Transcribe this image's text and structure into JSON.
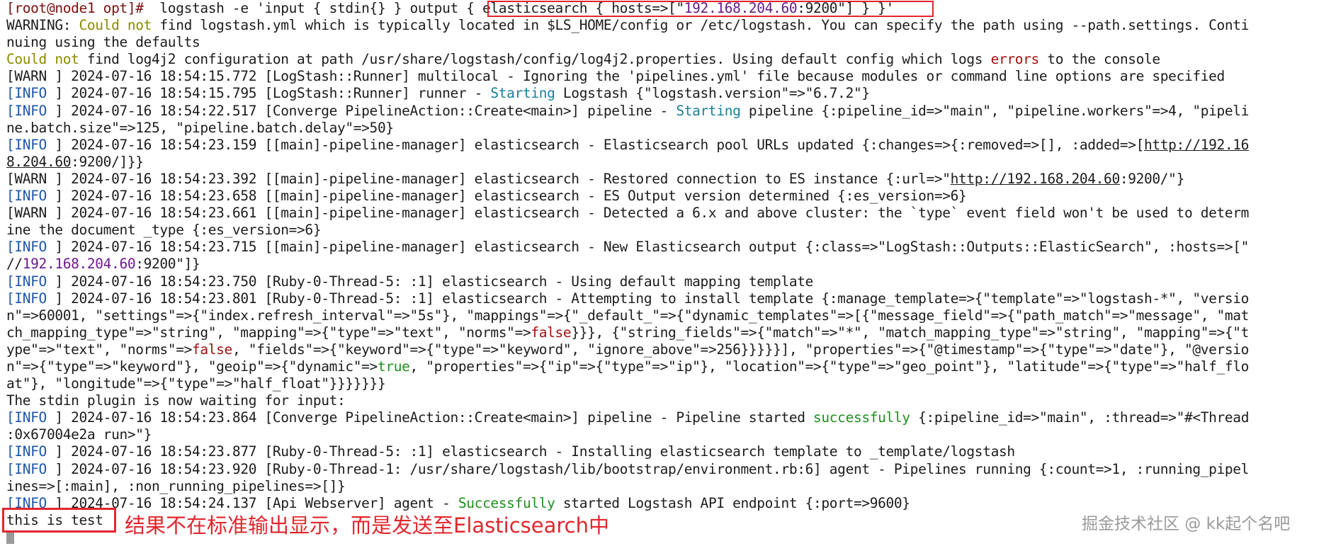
{
  "terminal": {
    "lines": [
      [
        {
          "t": "[root@node1 opt]#",
          "c": "prompt"
        },
        {
          "t": "  logstash -e 'input { stdin{} } output "
        },
        {
          "t": "{ elasticsearch { hosts=>[\""
        },
        {
          "t": "192.168.204.60",
          "c": "ip"
        },
        {
          "t": ":9200\"] } }"
        },
        {
          "t": "'"
        }
      ],
      [
        {
          "t": "WARNING: "
        },
        {
          "t": "Could not",
          "c": "warnword"
        },
        {
          "t": " find logstash.yml which is typically located in $LS_HOME/config or /etc/logstash. You can specify the path using --path.settings. Conti"
        }
      ],
      [
        {
          "t": "nuing using the defaults"
        }
      ],
      [
        {
          "t": "Could not",
          "c": "warnword"
        },
        {
          "t": " find log4j2 configuration at path /usr/share/logstash/config/log4j2.properties. Using default config which logs "
        },
        {
          "t": "errors",
          "c": "keyword"
        },
        {
          "t": " to the console"
        }
      ],
      [
        {
          "t": "[WARN ] 2024-07-16 18:54:15.772 [LogStash::Runner] multilocal - Ignoring the 'pipelines.yml' file because modules or command line options are specified"
        }
      ],
      [
        {
          "t": "[",
          "c": "bracket"
        },
        {
          "t": "INFO",
          "c": "bracket"
        },
        {
          "t": " ] 2024-07-16 18:54:15.795 [LogStash::Runner] runner - "
        },
        {
          "t": "Starting",
          "c": "starting"
        },
        {
          "t": " Logstash {\"logstash.version\"=>\"6.7.2\"}"
        }
      ],
      [
        {
          "t": "[",
          "c": "bracket"
        },
        {
          "t": "INFO",
          "c": "bracket"
        },
        {
          "t": " ] 2024-07-16 18:54:22.517 [Converge PipelineAction::Create<main>] pipeline - "
        },
        {
          "t": "Starting",
          "c": "starting"
        },
        {
          "t": " pipeline {:pipeline_id=>\"main\", \"pipeline.workers\"=>4, \"pipeli"
        }
      ],
      [
        {
          "t": "ne.batch.size\"=>125, \"pipeline.batch.delay\"=>50}"
        }
      ],
      [
        {
          "t": "[",
          "c": "bracket"
        },
        {
          "t": "INFO",
          "c": "bracket"
        },
        {
          "t": " ] 2024-07-16 18:54:23.159 [[main]-pipeline-manager] elasticsearch - Elasticsearch pool URLs updated {:changes=>{:removed=>[], :added=>["
        },
        {
          "t": "http://192.16",
          "c": "url"
        }
      ],
      [
        {
          "t": "8.204.60",
          "c": "url"
        },
        {
          "t": ":9200/]}}"
        }
      ],
      [
        {
          "t": "[WARN ] 2024-07-16 18:54:23.392 [[main]-pipeline-manager] elasticsearch - Restored connection to ES instance {:url=>\""
        },
        {
          "t": "http://192.168.204.60",
          "c": "url"
        },
        {
          "t": ":9200/\"}"
        }
      ],
      [
        {
          "t": "[",
          "c": "bracket"
        },
        {
          "t": "INFO",
          "c": "bracket"
        },
        {
          "t": " ] 2024-07-16 18:54:23.658 [[main]-pipeline-manager] elasticsearch - ES Output version determined {:es_version=>6}"
        }
      ],
      [
        {
          "t": "[WARN ] 2024-07-16 18:54:23.661 [[main]-pipeline-manager] elasticsearch - Detected a 6.x and above cluster: the `type` event field won't be used to determ"
        }
      ],
      [
        {
          "t": "ine the document _type {:es_version=>6}"
        }
      ],
      [
        {
          "t": "[",
          "c": "bracket"
        },
        {
          "t": "INFO",
          "c": "bracket"
        },
        {
          "t": " ] 2024-07-16 18:54:23.715 [[main]-pipeline-manager] elasticsearch - New Elasticsearch output {:class=>\"LogStash::Outputs::ElasticSearch\", :hosts=>[\""
        }
      ],
      [
        {
          "t": "//"
        },
        {
          "t": "192.168.204.60",
          "c": "ip"
        },
        {
          "t": ":9200\"]}"
        }
      ],
      [
        {
          "t": "[",
          "c": "bracket"
        },
        {
          "t": "INFO",
          "c": "bracket"
        },
        {
          "t": " ] 2024-07-16 18:54:23.750 [Ruby-0-Thread-5: :1] elasticsearch - Using default mapping template"
        }
      ],
      [
        {
          "t": "[",
          "c": "bracket"
        },
        {
          "t": "INFO",
          "c": "bracket"
        },
        {
          "t": " ] 2024-07-16 18:54:23.801 [Ruby-0-Thread-5: :1] elasticsearch - Attempting to install template {:manage_template=>{\"template\"=>\"logstash-*\", \"versio"
        }
      ],
      [
        {
          "t": "n\"=>60001, \"settings\"=>{\"index.refresh_interval\"=>\"5s\"}, \"mappings\"=>{\"_default_\"=>{\"dynamic_templates\"=>[{\"message_field\"=>{\"path_match\"=>\"message\", \"mat"
        }
      ],
      [
        {
          "t": "ch_mapping_type\"=>\"string\", \"mapping\"=>{\"type\"=>\"text\", \"norms\"=>"
        },
        {
          "t": "false",
          "c": "keyword"
        },
        {
          "t": "}}}, {\"string_fields\"=>{\"match\"=>\"*\", \"match_mapping_type\"=>\"string\", \"mapping\"=>{\"t"
        }
      ],
      [
        {
          "t": "ype\"=>\"text\", \"norms\"=>"
        },
        {
          "t": "false",
          "c": "keyword"
        },
        {
          "t": ", \"fields\"=>{\"keyword\"=>{\"type\"=>\"keyword\", \"ignore_above\"=>256}}}}}], \"properties\"=>{\"@timestamp\"=>{\"type\"=>\"date\"}, \"@versio"
        }
      ],
      [
        {
          "t": "n\"=>{\"type\"=>\"keyword\"}, \"geoip\"=>{\"dynamic\"=>"
        },
        {
          "t": "true",
          "c": "success"
        },
        {
          "t": ", \"properties\"=>{\"ip\"=>{\"type\"=>\"ip\"}, \"location\"=>{\"type\"=>\"geo_point\"}, \"latitude\"=>{\"type\"=>\"half_flo"
        }
      ],
      [
        {
          "t": "at\"}, \"longitude\"=>{\"type\"=>\"half_float\"}}}}}}}"
        }
      ],
      [
        {
          "t": "The stdin plugin is now waiting for input:"
        }
      ],
      [
        {
          "t": "[",
          "c": "bracket"
        },
        {
          "t": "INFO",
          "c": "bracket"
        },
        {
          "t": " ] 2024-07-16 18:54:23.864 [Converge PipelineAction::Create<main>] pipeline - Pipeline started "
        },
        {
          "t": "successfully",
          "c": "success"
        },
        {
          "t": " {:pipeline_id=>\"main\", :thread=>\"#<Thread"
        }
      ],
      [
        {
          "t": ":0x67004e2a run>\"}"
        }
      ],
      [
        {
          "t": "[",
          "c": "bracket"
        },
        {
          "t": "INFO",
          "c": "bracket"
        },
        {
          "t": " ] 2024-07-16 18:54:23.877 [Ruby-0-Thread-5: :1] elasticsearch - Installing elasticsearch template to _template/logstash"
        }
      ],
      [
        {
          "t": "[",
          "c": "bracket"
        },
        {
          "t": "INFO",
          "c": "bracket"
        },
        {
          "t": " ] 2024-07-16 18:54:23.920 [Ruby-0-Thread-1: /usr/share/logstash/lib/bootstrap/environment.rb:6] agent - Pipelines running {:count=>1, :running_pipel"
        }
      ],
      [
        {
          "t": "ines=>[:main], :non_running_pipelines=>[]}"
        }
      ],
      [
        {
          "t": "[",
          "c": "bracket"
        },
        {
          "t": "INFO",
          "c": "bracket"
        },
        {
          "t": " ] 2024-07-16 18:54:24.137 [Api Webserver] agent - "
        },
        {
          "t": "Successfully",
          "c": "success"
        },
        {
          "t": " started Logstash API endpoint {:port=>9600}"
        }
      ],
      [
        {
          "t": "this is test"
        }
      ]
    ]
  },
  "annotation": {
    "caption": "结果不在标准输出显示，而是发送至Elasticsearch中"
  },
  "watermark": "掘金技术社区 @ kk起个名吧",
  "colors": {
    "highlight_border": "#e2262d",
    "prompt": "#7a1010",
    "info": "#1f55a8",
    "success": "#1f8f1f"
  }
}
